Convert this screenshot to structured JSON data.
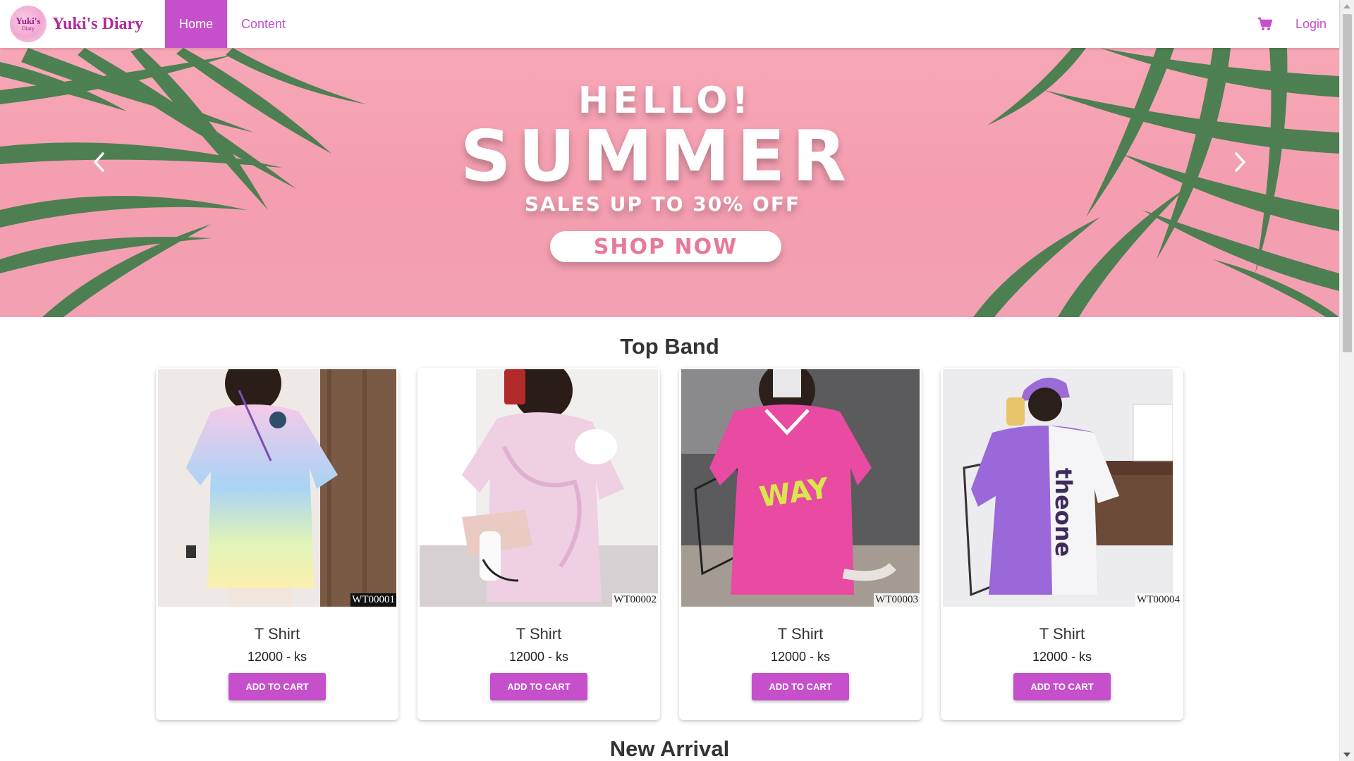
{
  "brand": {
    "name": "Yuki's Diary",
    "logo_text": "Yuki's",
    "logo_subtext": "Diary"
  },
  "nav": {
    "home": "Home",
    "content": "Content",
    "login": "Login",
    "cart_icon": "cart-icon"
  },
  "hero": {
    "line1": "HELLO!",
    "line2": "SUMMER",
    "line3": "SALES UP TO 30% OFF",
    "cta": "SHOP NOW",
    "prev_icon": "chevron-left-icon",
    "next_icon": "chevron-right-icon"
  },
  "sections": {
    "top_band": "Top Band",
    "new_arrival": "New Arrival"
  },
  "products": [
    {
      "sku": "WT00001",
      "name": "T Shirt",
      "price": "12000 - ks",
      "button": "ADD TO CART"
    },
    {
      "sku": "WT00002",
      "name": "T Shirt",
      "price": "12000 - ks",
      "button": "ADD TO CART"
    },
    {
      "sku": "WT00003",
      "name": "T Shirt",
      "price": "12000 - ks",
      "button": "ADD TO CART"
    },
    {
      "sku": "WT00004",
      "name": "T Shirt",
      "price": "12000 - ks",
      "button": "ADD TO CART"
    }
  ],
  "colors": {
    "accent": "#c64fcb",
    "brand_text": "#b02a9d",
    "hero_bg": "#f49eb0"
  }
}
